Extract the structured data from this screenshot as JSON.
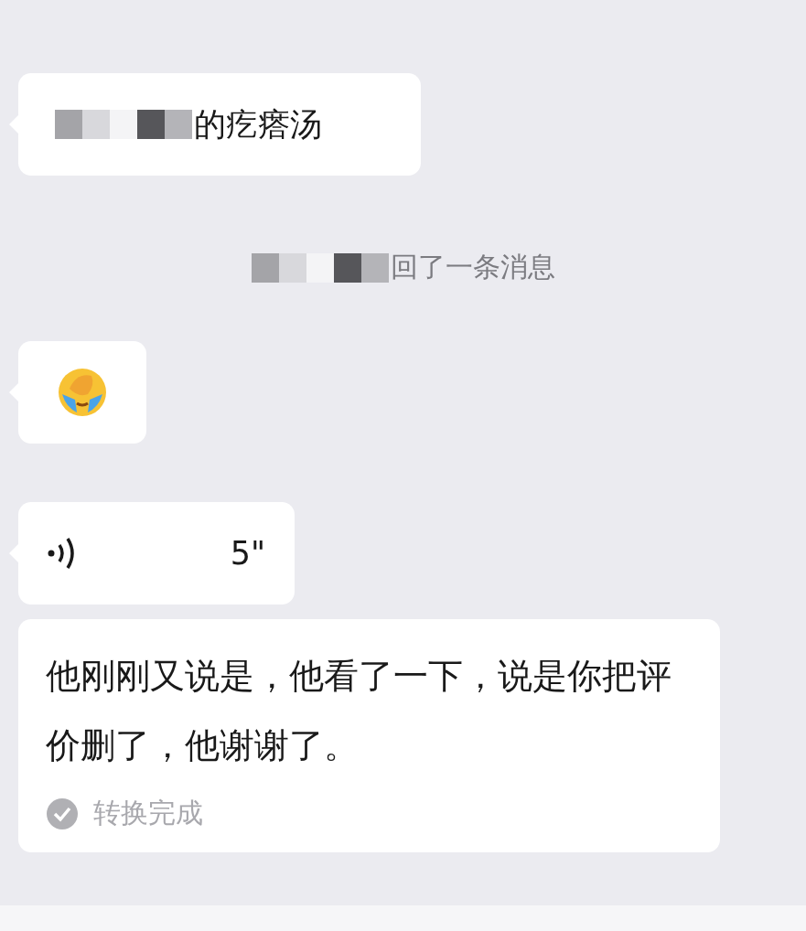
{
  "messages": [
    {
      "kind": "text",
      "redacted": true,
      "text": "的疙瘩汤"
    },
    {
      "kind": "notice",
      "redacted": true,
      "text": "回了一条消息"
    },
    {
      "kind": "emoji"
    },
    {
      "kind": "voice",
      "duration": "5\"",
      "transcript": {
        "text": "他刚刚又说是，他看了一下，说是你把评价删了，他谢谢了。",
        "status": "转换完成"
      }
    }
  ]
}
